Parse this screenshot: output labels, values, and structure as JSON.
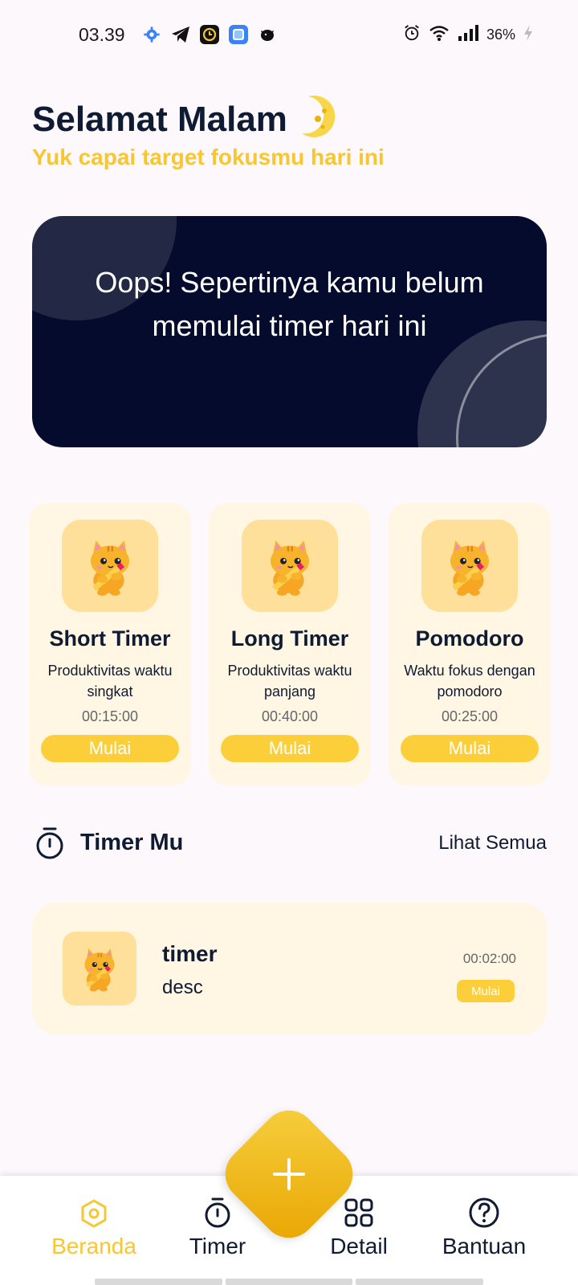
{
  "status_bar": {
    "time": "03.39",
    "battery": "36%",
    "left_icons": [
      "gear-icon",
      "telegram-icon",
      "clock-app-icon",
      "tasks-app-icon",
      "bird-app-icon"
    ],
    "right_icons": [
      "alarm-icon",
      "wifi-icon",
      "signal-icon",
      "charging-icon"
    ]
  },
  "greeting": {
    "title": "Selamat Malam",
    "subtitle": "Yuk capai target fokusmu hari ini",
    "icon": "moon-icon"
  },
  "banner": {
    "message": "Oops! Sepertinya kamu belum memulai timer hari ini"
  },
  "presets": [
    {
      "title": "Short Timer",
      "description": "Produktivitas waktu singkat",
      "duration": "00:15:00",
      "button_label": "Mulai"
    },
    {
      "title": "Long Timer",
      "description": "Produktivitas waktu panjang",
      "duration": "00:40:00",
      "button_label": "Mulai"
    },
    {
      "title": "Pomodoro",
      "description": "Waktu fokus dengan pomodoro",
      "duration": "00:25:00",
      "button_label": "Mulai"
    }
  ],
  "timer_section": {
    "title": "Timer Mu",
    "see_all_label": "Lihat Semua",
    "icon": "stopwatch-icon"
  },
  "timers": [
    {
      "name": "timer",
      "description": "desc",
      "duration": "00:02:00",
      "button_label": "Mulai"
    }
  ],
  "bottom_nav": {
    "items": [
      {
        "label": "Beranda",
        "icon": "home-icon",
        "active": true
      },
      {
        "label": "Timer",
        "icon": "timer-icon",
        "active": false
      },
      {
        "label": "Detail",
        "icon": "grid-icon",
        "active": false
      },
      {
        "label": "Bantuan",
        "icon": "help-icon",
        "active": false
      }
    ],
    "fab_icon": "plus-icon"
  },
  "colors": {
    "accent": "#f7c631",
    "button": "#fccf3a",
    "navy": "#050b2c",
    "card_bg": "#fff6e3",
    "text_dark": "#0f1b33"
  }
}
